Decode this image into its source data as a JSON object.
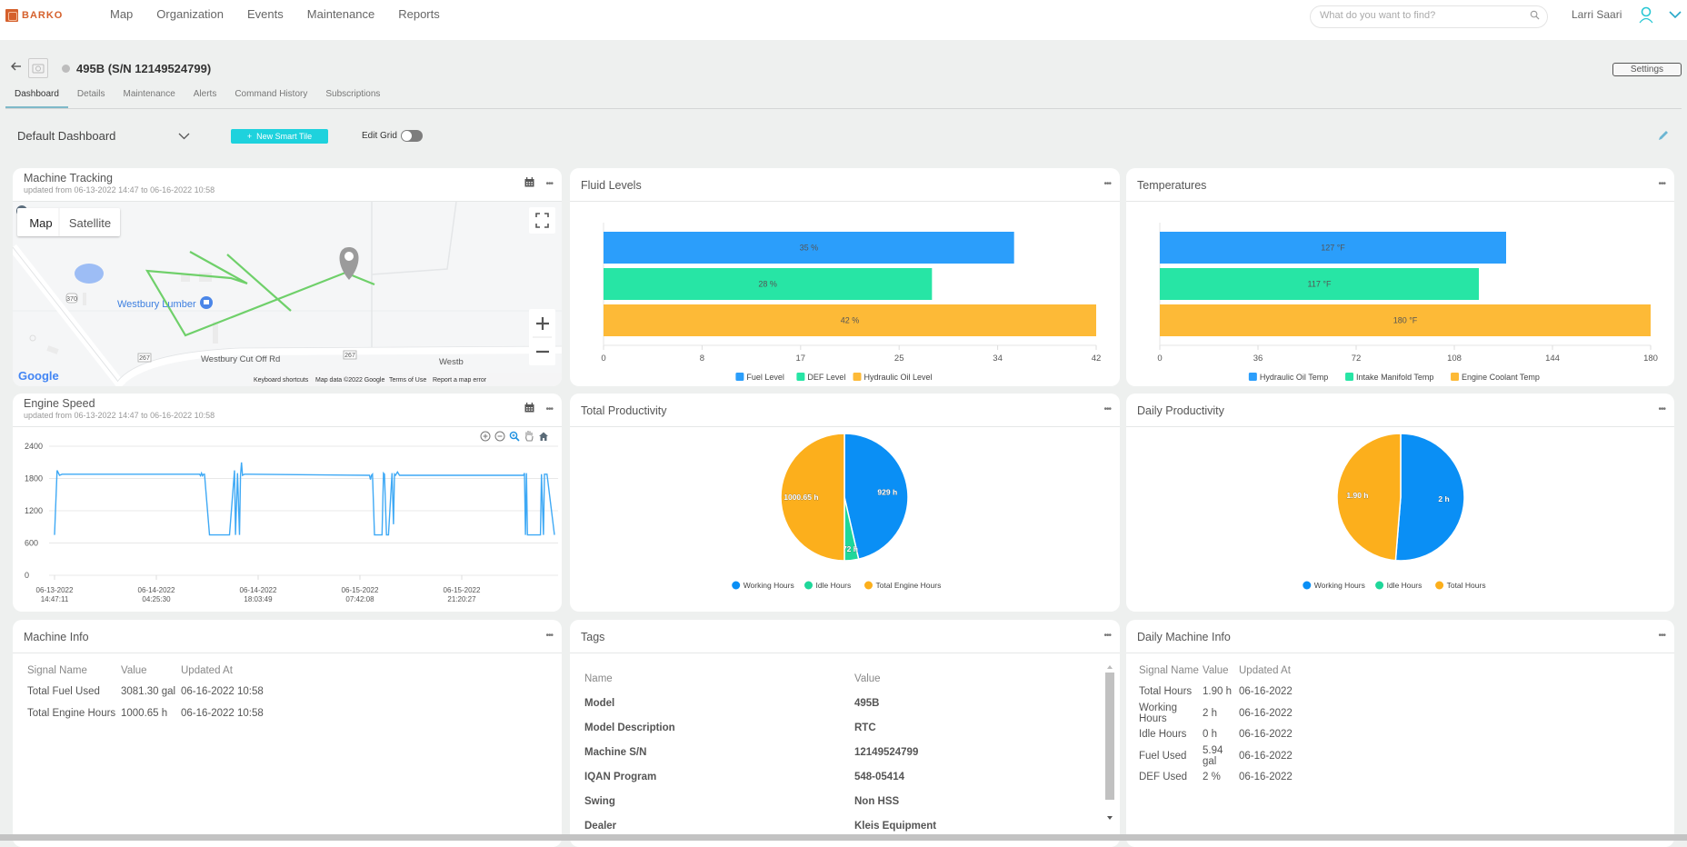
{
  "app": {
    "brand": "BARKO",
    "brand_color": "#d5602c",
    "accent": "#1ed2dd"
  },
  "nav": {
    "items": [
      "Map",
      "Organization",
      "Events",
      "Maintenance",
      "Reports"
    ]
  },
  "search": {
    "placeholder": "What do you want to find?"
  },
  "user": {
    "name": "Larri Saari"
  },
  "machine": {
    "title": "495B (S/N 12149524799)",
    "settings_label": "Settings",
    "status": "offline"
  },
  "tabs": [
    {
      "label": "Dashboard",
      "active": true
    },
    {
      "label": "Details"
    },
    {
      "label": "Maintenance"
    },
    {
      "label": "Alerts"
    },
    {
      "label": "Command History"
    },
    {
      "label": "Subscriptions"
    }
  ],
  "toolbar": {
    "dashboard_select": "Default Dashboard",
    "new_tile_label": "New Smart Tile",
    "edit_grid_label": "Edit Grid",
    "edit_grid_on": false
  },
  "tracking": {
    "title": "Machine Tracking",
    "subtitle": "updated from 06-13-2022 14:47 to 06-16-2022 10:58",
    "map_btn": "Map",
    "satellite_btn": "Satellite",
    "labels": {
      "poi": "Westbury Lumber",
      "road": "Westbury Cut Off Rd",
      "road_cut": "Westb",
      "route370": "370",
      "route267a": "267",
      "route267b": "267"
    },
    "attribution": [
      "Keyboard shortcuts",
      "Map data ©2022 Google",
      "Terms of Use",
      "Report a map error"
    ],
    "google": "Google"
  },
  "fluid": {
    "title": "Fluid Levels"
  },
  "temps": {
    "title": "Temperatures"
  },
  "engine": {
    "title": "Engine Speed",
    "subtitle": "updated from 06-13-2022 14:47 to 06-16-2022 10:58"
  },
  "total_prod": {
    "title": "Total Productivity"
  },
  "daily_prod": {
    "title": "Daily Productivity"
  },
  "machine_info": {
    "title": "Machine Info",
    "headers": [
      "Signal Name",
      "Value",
      "Updated At"
    ],
    "rows": [
      [
        "Total Fuel Used",
        "3081.30 gal",
        "06-16-2022 10:58"
      ],
      [
        "Total Engine Hours",
        "1000.65 h",
        "06-16-2022 10:58"
      ]
    ]
  },
  "tags": {
    "title": "Tags",
    "headers": [
      "Name",
      "Value"
    ],
    "rows": [
      [
        "Model",
        "495B"
      ],
      [
        "Model Description",
        "RTC"
      ],
      [
        "Machine S/N",
        "12149524799"
      ],
      [
        "IQAN Program",
        "548-05414"
      ],
      [
        "Swing",
        "Non HSS"
      ],
      [
        "Dealer",
        "Kleis Equipment"
      ]
    ]
  },
  "daily_info": {
    "title": "Daily Machine Info",
    "headers": [
      "Signal Name",
      "Value",
      "Updated At"
    ],
    "rows": [
      [
        "Total Hours",
        "1.90 h",
        "06-16-2022"
      ],
      [
        "Working Hours",
        "2 h",
        "06-16-2022"
      ],
      [
        "Idle Hours",
        "0 h",
        "06-16-2022"
      ],
      [
        "Fuel Used",
        "5.94 gal",
        "06-16-2022"
      ],
      [
        "DEF Used",
        "2 %",
        "06-16-2022"
      ]
    ]
  },
  "chart_data": [
    {
      "id": "fluid",
      "type": "bar",
      "orientation": "horizontal",
      "title": "Fluid Levels",
      "categories": [
        "Fuel Level",
        "DEF Level",
        "Hydraulic Oil Level"
      ],
      "values": [
        35,
        28,
        42
      ],
      "labels": [
        "35 %",
        "28 %",
        "42 %"
      ],
      "colors": [
        "#2b9efb",
        "#27e5a5",
        "#fdba37"
      ],
      "xlim": [
        0,
        42
      ],
      "xticks": [
        "0",
        "8",
        "17",
        "25",
        "34",
        "42"
      ],
      "legend": "bottom"
    },
    {
      "id": "temps",
      "type": "bar",
      "orientation": "horizontal",
      "title": "Temperatures",
      "categories": [
        "Hydraulic Oil Temp",
        "Intake Manifold Temp",
        "Engine Coolant Temp"
      ],
      "values": [
        127,
        117,
        180
      ],
      "labels": [
        "127 °F",
        "117 °F",
        "180 °F"
      ],
      "colors": [
        "#2b9efb",
        "#27e5a5",
        "#fdba37"
      ],
      "xlim": [
        0,
        180
      ],
      "xticks": [
        "0",
        "36",
        "72",
        "108",
        "144",
        "180"
      ],
      "legend": "bottom"
    },
    {
      "id": "engine",
      "type": "line",
      "title": "Engine Speed",
      "ylim": [
        0,
        2400
      ],
      "yticks": [
        "2400",
        "1800",
        "1200",
        "600",
        "0"
      ],
      "xticks": [
        [
          "06-13-2022",
          "14:47:11"
        ],
        [
          "06-14-2022",
          "04:25:30"
        ],
        [
          "06-14-2022",
          "18:03:49"
        ],
        [
          "06-15-2022",
          "07:42:08"
        ],
        [
          "06-15-2022",
          "21:20:27"
        ]
      ],
      "x": [
        0,
        0.005,
        0.01,
        0.015,
        0.02,
        0.29,
        0.292,
        0.294,
        0.296,
        0.298,
        0.3,
        0.31,
        0.35,
        0.36,
        0.362,
        0.366,
        0.37,
        0.372,
        0.374,
        0.376,
        0.38,
        0.384,
        0.386,
        0.39,
        0.63,
        0.632,
        0.634,
        0.636,
        0.64,
        0.655,
        0.658,
        0.66,
        0.664,
        0.668,
        0.675,
        0.678,
        0.68,
        0.682,
        0.686,
        0.69,
        0.938,
        0.94,
        0.942,
        0.944,
        0.946,
        0.95,
        0.97,
        0.972,
        0.974,
        0.978,
        0.98,
        0.985,
        1.0
      ],
      "values": [
        750,
        1950,
        1860,
        1880,
        1880,
        1880,
        1850,
        1900,
        1850,
        1880,
        1880,
        750,
        750,
        1950,
        750,
        1900,
        750,
        1860,
        2100,
        1860,
        1880,
        1880,
        1880,
        1880,
        1860,
        1780,
        1860,
        1880,
        750,
        750,
        1900,
        1880,
        750,
        750,
        1900,
        950,
        1880,
        1860,
        1920,
        1860,
        1860,
        1900,
        750,
        1900,
        750,
        750,
        750,
        750,
        1880,
        750,
        1880,
        1880,
        750
      ],
      "color": "#3fa9f5"
    },
    {
      "id": "total_prod",
      "type": "pie",
      "title": "Total Productivity",
      "categories": [
        "Working Hours",
        "Idle Hours",
        "Total Engine Hours"
      ],
      "values": [
        929,
        72,
        1000.65
      ],
      "labels": [
        "929 h",
        "72 h",
        "1000.65 h"
      ],
      "colors": [
        "#0a8ff5",
        "#1fd79a",
        "#fcaf1c"
      ],
      "legend": "bottom"
    },
    {
      "id": "daily_prod",
      "type": "pie",
      "title": "Daily Productivity",
      "categories": [
        "Working Hours",
        "Idle Hours",
        "Total Hours"
      ],
      "values": [
        2,
        0,
        1.9
      ],
      "labels": [
        "2 h",
        "",
        "1.90 h"
      ],
      "colors": [
        "#0a8ff5",
        "#1fd79a",
        "#fcaf1c"
      ],
      "legend": "bottom"
    }
  ]
}
